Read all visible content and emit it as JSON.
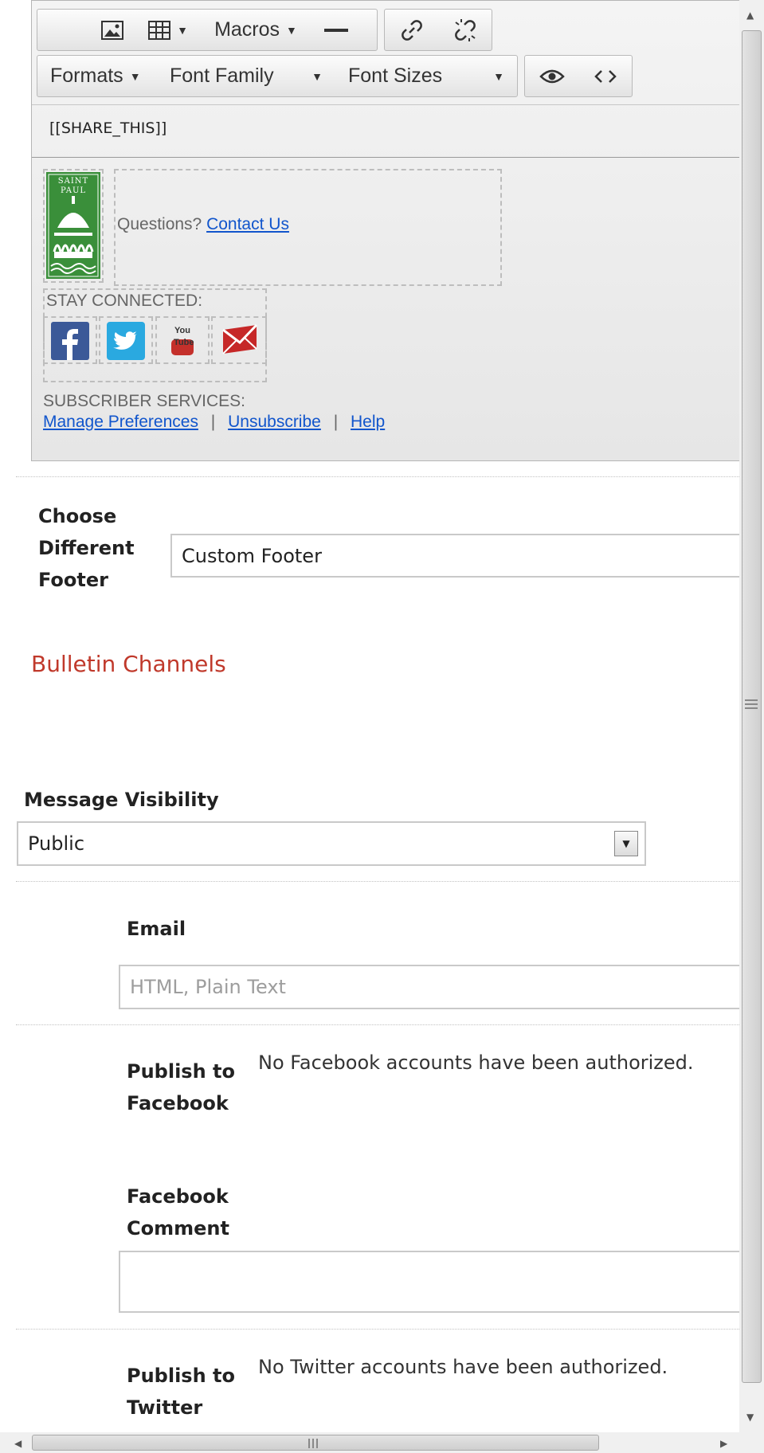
{
  "toolbar": {
    "row1": {
      "macros_label": "Macros"
    },
    "row2": {
      "formats_label": "Formats",
      "font_family_label": "Font Family",
      "font_sizes_label": "Font Sizes"
    }
  },
  "editor": {
    "share_token": "[[SHARE_THIS]]",
    "logo_text": "SAINT PAUL",
    "questions_text": "Questions?",
    "contact_link": "Contact Us",
    "stay_connected": "STAY CONNECTED:",
    "social_icons": [
      "facebook-icon",
      "twitter-icon",
      "youtube-icon",
      "email-icon"
    ],
    "youtube_text": "You Tube",
    "subscriber_services": "SUBSCRIBER SERVICES:",
    "links": {
      "manage": "Manage Preferences",
      "unsubscribe": "Unsubscribe",
      "help": "Help",
      "separator": "|"
    }
  },
  "footer_select": {
    "label": "Choose Different Footer",
    "value": "Custom Footer"
  },
  "bulletin_channels": {
    "title": "Bulletin Channels"
  },
  "message_visibility": {
    "label": "Message Visibility",
    "value": "Public"
  },
  "email": {
    "label": "Email",
    "placeholder": "HTML, Plain Text"
  },
  "facebook": {
    "label": "Publish to Facebook",
    "note": "No Facebook accounts have been authorized.",
    "comment_label": "Facebook Comment",
    "comment_value": ""
  },
  "twitter": {
    "label": "Publish to Twitter",
    "note": "No Twitter accounts have been authorized."
  },
  "colors": {
    "section_title": "#c0392b",
    "link": "#1155cc",
    "logo_green": "#3a8f3a"
  }
}
